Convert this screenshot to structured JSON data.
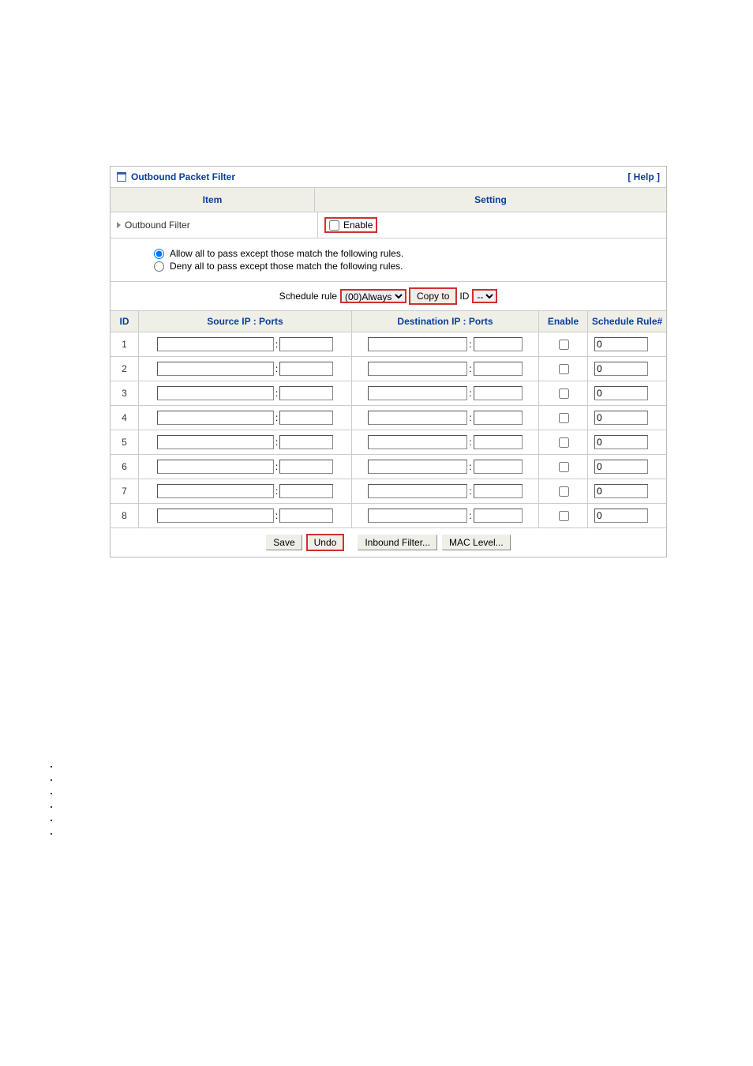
{
  "panel": {
    "title": "Outbound Packet Filter",
    "help": "[ Help ]",
    "item_header": "Item",
    "setting_header": "Setting",
    "outbound_filter_label": "Outbound Filter",
    "enable_label": "Enable",
    "enable_checked": false,
    "radio_allow": "Allow all to pass except those match the following rules.",
    "radio_deny": "Deny all to pass except those match the following rules.",
    "radio_selected": "allow",
    "schedule_label": "Schedule rule",
    "schedule_option": "(00)Always",
    "copy_to": "Copy to",
    "id_label": "ID",
    "id_option": "--"
  },
  "columns": {
    "id": "ID",
    "src": "Source IP : Ports",
    "dst": "Destination IP : Ports",
    "enable": "Enable",
    "rule": "Schedule Rule#"
  },
  "rows": [
    {
      "id": "1",
      "src_ip": "",
      "src_port": "",
      "dst_ip": "",
      "dst_port": "",
      "enable": false,
      "rule": "0"
    },
    {
      "id": "2",
      "src_ip": "",
      "src_port": "",
      "dst_ip": "",
      "dst_port": "",
      "enable": false,
      "rule": "0"
    },
    {
      "id": "3",
      "src_ip": "",
      "src_port": "",
      "dst_ip": "",
      "dst_port": "",
      "enable": false,
      "rule": "0"
    },
    {
      "id": "4",
      "src_ip": "",
      "src_port": "",
      "dst_ip": "",
      "dst_port": "",
      "enable": false,
      "rule": "0"
    },
    {
      "id": "5",
      "src_ip": "",
      "src_port": "",
      "dst_ip": "",
      "dst_port": "",
      "enable": false,
      "rule": "0"
    },
    {
      "id": "6",
      "src_ip": "",
      "src_port": "",
      "dst_ip": "",
      "dst_port": "",
      "enable": false,
      "rule": "0"
    },
    {
      "id": "7",
      "src_ip": "",
      "src_port": "",
      "dst_ip": "",
      "dst_port": "",
      "enable": false,
      "rule": "0"
    },
    {
      "id": "8",
      "src_ip": "",
      "src_port": "",
      "dst_ip": "",
      "dst_port": "",
      "enable": false,
      "rule": "0"
    }
  ],
  "buttons": {
    "save": "Save",
    "undo": "Undo",
    "inbound": "Inbound Filter...",
    "mac": "MAC Level..."
  },
  "bullets": [
    "",
    "",
    "",
    "",
    "",
    ""
  ]
}
